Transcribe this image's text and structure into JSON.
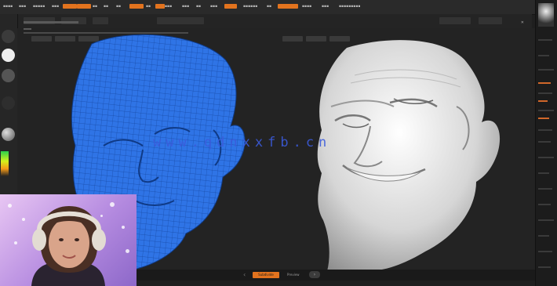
{
  "watermark": "www.qdnxxfb.cn",
  "colors": {
    "accent": "#e2731e",
    "mesh_blue": "#2f74e6",
    "viewport_bg": "#232323",
    "sculpt_white": "#d9d9d9"
  },
  "bottom": {
    "subdiv_label": "Subdivide",
    "preview_label": "Preview",
    "prev_icon": "chevron-left-icon",
    "next_icon": "chevron-right-icon"
  }
}
